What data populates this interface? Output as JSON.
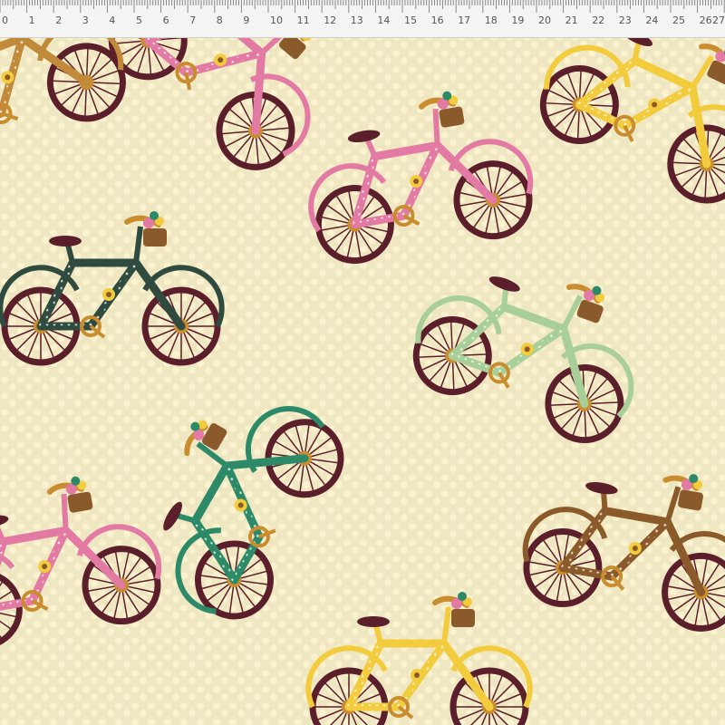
{
  "ruler": {
    "labels": [
      "0",
      "1",
      "2",
      "3",
      "4",
      "5",
      "6",
      "7",
      "8",
      "9",
      "10",
      "11",
      "12",
      "13",
      "14",
      "15",
      "16",
      "17",
      "18",
      "19",
      "20",
      "21",
      "22",
      "23",
      "24",
      "25",
      "26",
      "27"
    ]
  },
  "fabric": {
    "background": "#efe6c2",
    "dots": "#fbf3cf",
    "frame_colors": {
      "pink": "#e27aa4",
      "floral_dark": "#2f4a3e",
      "green": "#a9cf98",
      "yellow": "#f2cc3c",
      "teal": "#2d8a68",
      "brown_print": "#8a5a2a"
    },
    "wheel_color": "#5b1f2b",
    "hub_color": "#c98d2f"
  }
}
